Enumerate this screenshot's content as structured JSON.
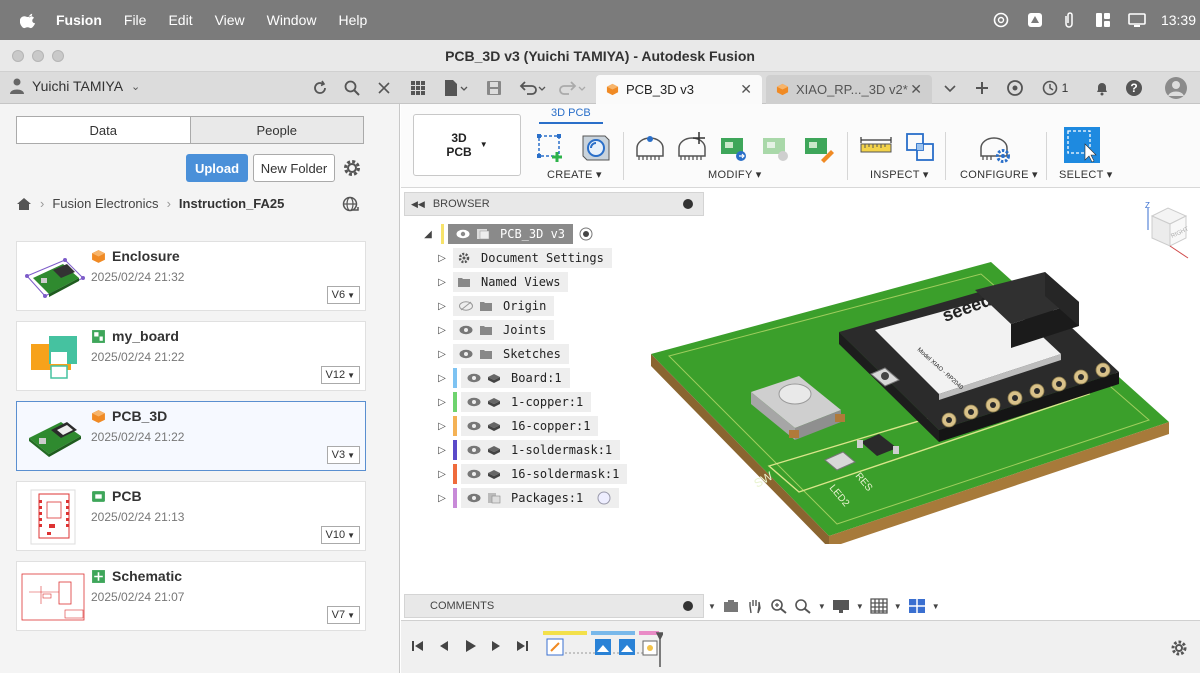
{
  "menubar": {
    "app_name": "Fusion",
    "menus": [
      "File",
      "Edit",
      "View",
      "Window",
      "Help"
    ],
    "clock": "13:39"
  },
  "window": {
    "title": "PCB_3D v3 (Yuichi TAMIYA) - Autodesk Fusion"
  },
  "toolbar": {
    "user_name": "Yuichi TAMIYA",
    "jobs_count": "1",
    "tabs": [
      {
        "label": "PCB_3D v3",
        "active": true
      },
      {
        "label": "XIAO_RP..._3D v2*",
        "active": false
      }
    ]
  },
  "data_panel": {
    "segments": [
      "Data",
      "People"
    ],
    "upload_label": "Upload",
    "new_folder_label": "New Folder",
    "breadcrumb": [
      "Fusion Electronics",
      "Instruction_FA25"
    ],
    "items": [
      {
        "name": "Enclosure",
        "date": "2025/02/24 21:32",
        "version": "V6",
        "type": "design"
      },
      {
        "name": "my_board",
        "date": "2025/02/24 21:22",
        "version": "V12",
        "type": "board"
      },
      {
        "name": "PCB_3D",
        "date": "2025/02/24 21:22",
        "version": "V3",
        "type": "design",
        "selected": true
      },
      {
        "name": "PCB",
        "date": "2025/02/24 21:13",
        "version": "V10",
        "type": "pcb"
      },
      {
        "name": "Schematic",
        "date": "2025/02/24 21:07",
        "version": "V7",
        "type": "schematic"
      }
    ]
  },
  "ribbon": {
    "workspace": "3D\nPCB",
    "active_tab": "3D PCB",
    "groups": [
      "CREATE",
      "MODIFY",
      "INSPECT",
      "CONFIGURE",
      "SELECT"
    ]
  },
  "browser": {
    "header": "BROWSER",
    "root": "PCB_3D v3",
    "nodes": [
      {
        "label": "Document Settings",
        "icon": "gear-icon",
        "color": ""
      },
      {
        "label": "Named Views",
        "icon": "folder-icon",
        "color": ""
      },
      {
        "label": "Origin",
        "icon": "folder-icon",
        "color": "",
        "hidden": true
      },
      {
        "label": "Joints",
        "icon": "folder-icon",
        "color": ""
      },
      {
        "label": "Sketches",
        "icon": "folder-icon",
        "color": ""
      },
      {
        "label": "Board:1",
        "icon": "body-icon",
        "color": "#7ec3f2"
      },
      {
        "label": "1-copper:1",
        "icon": "body-icon",
        "color": "#6ed36e"
      },
      {
        "label": "16-copper:1",
        "icon": "body-icon",
        "color": "#f4b255"
      },
      {
        "label": "1-soldermask:1",
        "icon": "body-icon",
        "color": "#5b4ac9"
      },
      {
        "label": "16-soldermask:1",
        "icon": "body-icon",
        "color": "#ef6b3c"
      },
      {
        "label": "Packages:1",
        "icon": "component-icon",
        "color": "#c88ad8"
      }
    ]
  },
  "comments": {
    "header": "COMMENTS"
  },
  "model": {
    "chip_brand": "seeedi",
    "chip_model": "Model XIAO - RP2040",
    "labels": [
      "SW",
      "RES",
      "LED2"
    ]
  },
  "viewcube": {
    "face": "RIGHT",
    "axis": "Z"
  }
}
